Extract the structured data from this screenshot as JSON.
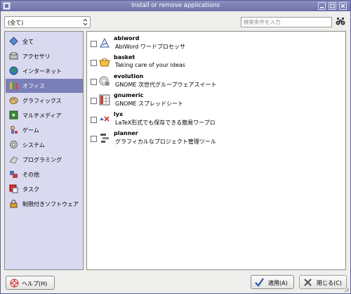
{
  "window": {
    "title": "Install or remove applications",
    "controls": [
      "minimize-icon",
      "maximize-icon",
      "close-icon"
    ]
  },
  "filter": {
    "value": "(全て)"
  },
  "search": {
    "placeholder": "検索条件を入力",
    "value": ""
  },
  "sidebar": {
    "items": [
      {
        "label": "全て",
        "icon": "all-icon"
      },
      {
        "label": "アクセサリ",
        "icon": "accessories-icon"
      },
      {
        "label": "インターネット",
        "icon": "internet-icon"
      },
      {
        "label": "オフィス",
        "icon": "office-icon",
        "selected": true
      },
      {
        "label": "グラフィックス",
        "icon": "graphics-icon"
      },
      {
        "label": "マルチメディア",
        "icon": "multimedia-icon"
      },
      {
        "label": "ゲーム",
        "icon": "games-icon"
      },
      {
        "label": "システム",
        "icon": "system-icon"
      },
      {
        "label": "プログラミング",
        "icon": "programming-icon"
      },
      {
        "label": "その他",
        "icon": "other-icon"
      },
      {
        "label": "タスク",
        "icon": "tasks-icon"
      },
      {
        "label": "制限付きソフトウェア",
        "icon": "restricted-icon"
      }
    ]
  },
  "apps": [
    {
      "name": "abiword",
      "description": "AbiWord ワードプロセッサ",
      "icon": "abiword-icon",
      "checked": false
    },
    {
      "name": "basket",
      "description": "Taking care of your ideas",
      "icon": "basket-icon",
      "checked": false
    },
    {
      "name": "evolution",
      "description": "GNOME 次世代グループウェアスイート",
      "icon": "evolution-icon",
      "checked": false
    },
    {
      "name": "gnumeric",
      "description": "GNOME スプレッドシート",
      "icon": "gnumeric-icon",
      "checked": false
    },
    {
      "name": "lyx",
      "description": "LaTeX形式でも保存できる簡易ワープロ",
      "icon": "lyx-icon",
      "checked": false
    },
    {
      "name": "planner",
      "description": "グラフィカルなプロジェクト管理ツール",
      "icon": "planner-icon",
      "checked": false
    }
  ],
  "buttons": {
    "help": "ヘルプ(H)",
    "apply": "適用(A)",
    "close": "閉じる(C)"
  },
  "colors": {
    "titlebar": "#6c71a8",
    "sidebar_bg": "#d9d9f0",
    "selection": "#7a7fb8"
  }
}
